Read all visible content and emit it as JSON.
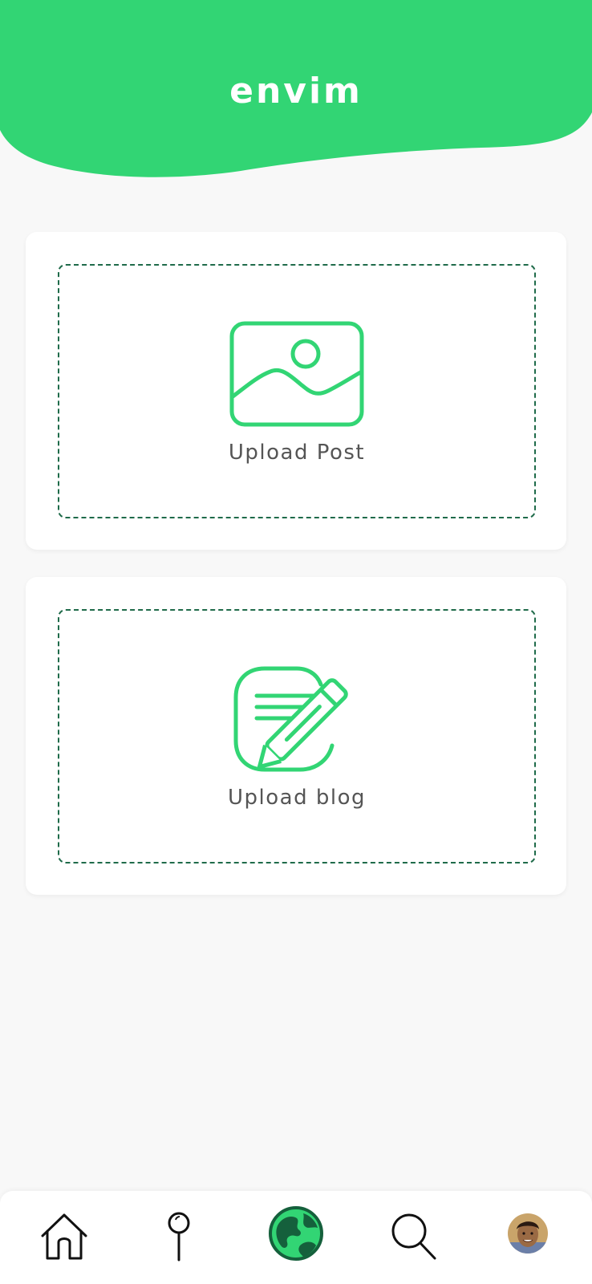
{
  "header": {
    "title": "envim"
  },
  "cards": {
    "post": {
      "label": "Upload Post",
      "icon": "image-icon"
    },
    "blog": {
      "label": "Upload blog",
      "icon": "edit-note-icon"
    }
  },
  "bottom_nav": {
    "items": [
      {
        "icon": "home-icon"
      },
      {
        "icon": "map-pin-icon"
      },
      {
        "icon": "globe-icon",
        "active": true
      },
      {
        "icon": "search-icon"
      },
      {
        "icon": "avatar"
      }
    ]
  },
  "colors": {
    "brand_green": "#32d574",
    "dashed_border": "#1f6b4a",
    "background": "#f8f8f8"
  }
}
